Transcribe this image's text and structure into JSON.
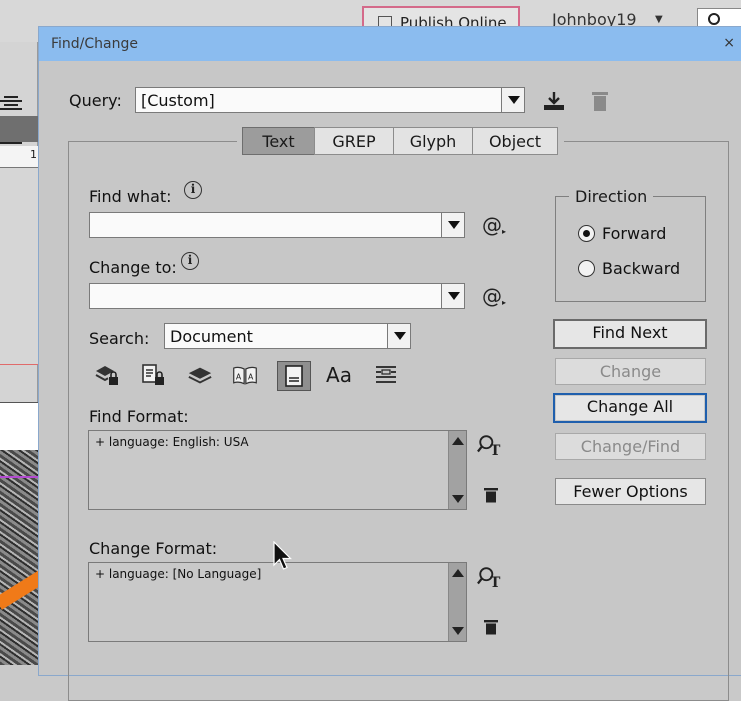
{
  "app": {
    "publish_label": "Publish Online",
    "user": "Johnboy19",
    "ruler_number": "1"
  },
  "dialog": {
    "title": "Find/Change",
    "close": "×",
    "query": {
      "label": "Query:",
      "value": "[Custom]"
    },
    "tabs": [
      {
        "label": "Text",
        "active": true
      },
      {
        "label": "GREP",
        "active": false
      },
      {
        "label": "Glyph",
        "active": false
      },
      {
        "label": "Object",
        "active": false
      }
    ],
    "find_what": {
      "label": "Find what:",
      "value": ""
    },
    "change_to": {
      "label": "Change to:",
      "value": ""
    },
    "search": {
      "label": "Search:",
      "value": "Document"
    },
    "find_format": {
      "label": "Find Format:",
      "text": "+ language: English: USA"
    },
    "change_format": {
      "label": "Change Format:",
      "text": "+ language: [No Language]"
    },
    "direction": {
      "title": "Direction",
      "options": [
        {
          "label": "Forward",
          "selected": true
        },
        {
          "label": "Backward",
          "selected": false
        }
      ]
    },
    "buttons": {
      "find_next": "Find Next",
      "change": "Change",
      "change_all": "Change All",
      "change_find": "Change/Find",
      "fewer_options": "Fewer Options"
    },
    "toolbar_icons": [
      "include-locked-layers-icon",
      "include-locked-stories-icon",
      "include-hidden-layers-icon",
      "include-master-pages-icon",
      "include-footnotes-icon",
      "case-sensitive-icon",
      "whole-word-icon"
    ],
    "case_glyph": "Aa"
  }
}
